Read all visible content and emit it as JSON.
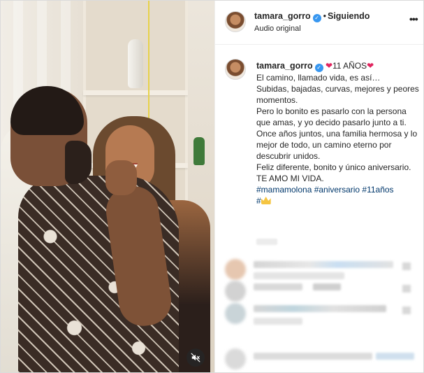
{
  "post": {
    "username": "tamara_gorro",
    "header": {
      "separator": "•",
      "follow_status": "Siguiendo",
      "audio_label": "Audio original",
      "more_icon": "more-horizontal-icon"
    },
    "caption": {
      "title": "11 AÑOS",
      "lines": [
        "El camino, llamado vida, es así…",
        "Subidas, bajadas, curvas, mejores y peores momentos.",
        "Pero lo bonito es pasarlo con la persona que amas, y yo decido pasarlo junto a ti.",
        "Once años juntos, una familia hermosa y lo mejor de todo, un camino eterno por descubrir unidos.",
        "Feliz diferente, bonito y único aniversario.",
        "TE AMO MI VIDA."
      ],
      "hashtags": "#mamamolona #aniversario #11años",
      "last_tag": "#"
    },
    "media": {
      "mute_icon": "muted-speaker-icon"
    },
    "colors": {
      "verified_blue": "#3897f0",
      "hashtag_blue": "#00376b",
      "heart_red": "#e0245e"
    }
  }
}
